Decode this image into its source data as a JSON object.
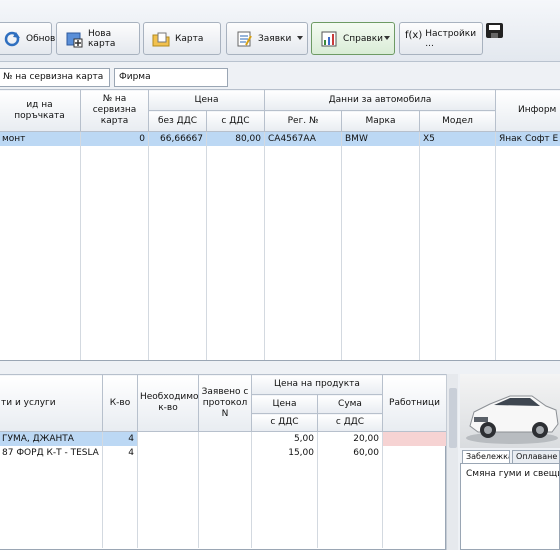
{
  "toolbar": {
    "buttons": [
      {
        "label": "Обнови"
      },
      {
        "label": "Нова карта"
      },
      {
        "label": "Карта"
      },
      {
        "label": "Заявки"
      },
      {
        "label": "Справки"
      },
      {
        "label": "Настройки ..."
      }
    ],
    "func_icon_label": "f(x)"
  },
  "search": {
    "service_card_no_label": "№ на сервизна карта",
    "company_label": "Фирма"
  },
  "orders_table": {
    "headers": {
      "order_type": "ид на поръчката",
      "service_card_no": "№ на сервизна карта",
      "price_group": "Цена",
      "price_no_vat": "без ДДС",
      "price_with_vat": "с ДДС",
      "car_group": "Данни за автомобила",
      "reg_no": "Рег. №",
      "make": "Марка",
      "model": "Модел",
      "info_group": "Информ"
    },
    "rows": [
      {
        "order_type": "монт",
        "service_card_no": "0",
        "price_no_vat": "66,66667",
        "price_with_vat": "80,00",
        "reg_no": "CA4567AA",
        "make": "BMW",
        "model": "X5",
        "info": "Янак Софт Е"
      }
    ]
  },
  "items_table": {
    "headers": {
      "item": "ти и услуги",
      "qty": "К-во",
      "required_qty": "Необходимо к-во",
      "protocol_qty": "Заявено с протокол N",
      "product_price_group": "Цена на продукта",
      "price": "Цена",
      "sum": "Сума",
      "vat1": "с ДДС",
      "vat2": "с ДДС",
      "workers": "Работници"
    },
    "rows": [
      {
        "item": "ГУМА, ДЖАНТА",
        "qty": "4",
        "price": "5,00",
        "sum": "20,00"
      },
      {
        "item": "87 ФОРД К-Т - TESLA",
        "qty": "4",
        "price": "15,00",
        "sum": "60,00"
      }
    ]
  },
  "side_panel": {
    "tabs": [
      "Забележка",
      "Оплаване"
    ],
    "note_text": "Смяна гуми и свещи"
  },
  "colors": {
    "selection": "#bcd8f4",
    "worker_cell": "#f6d3d3",
    "active_button": "#d9ecd6"
  }
}
